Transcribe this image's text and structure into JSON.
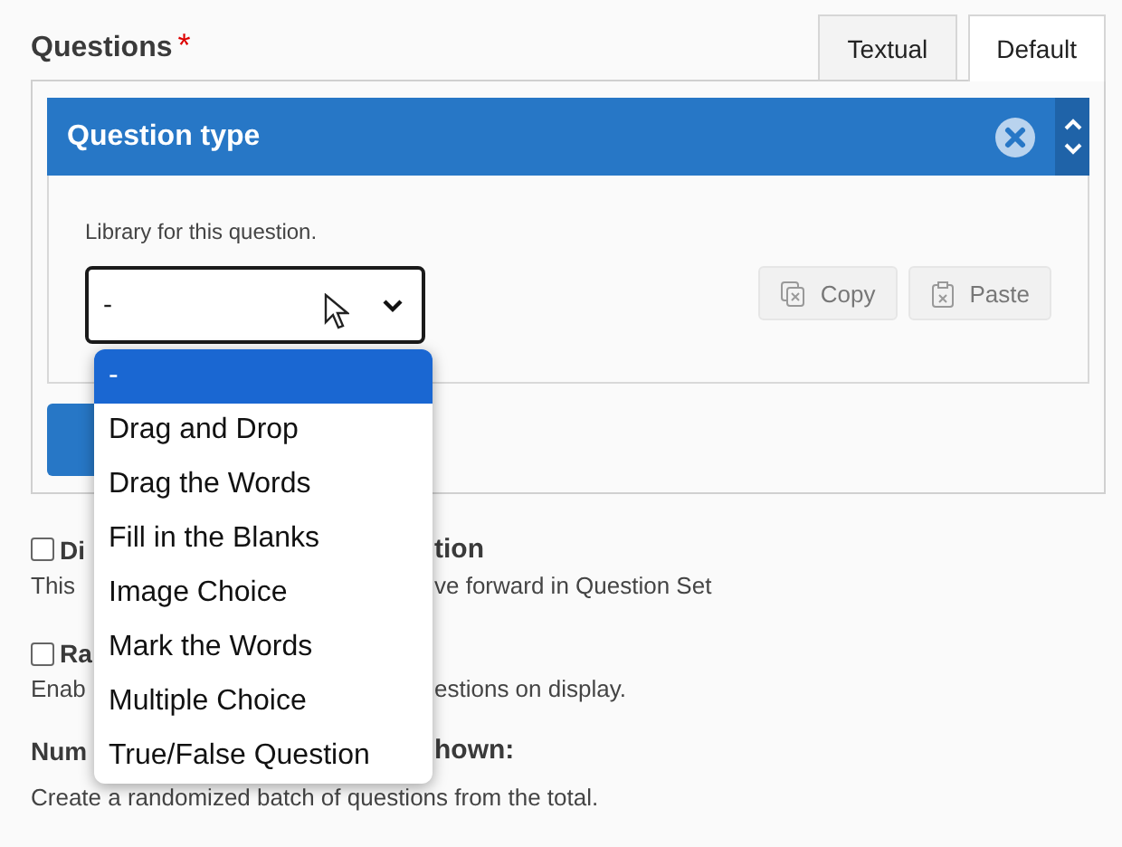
{
  "field": {
    "label": "Questions",
    "required_mark": "*"
  },
  "tabs": [
    {
      "label": "Textual",
      "selected": false
    },
    {
      "label": "Default",
      "selected": true
    }
  ],
  "question_type": {
    "title": "Question type",
    "library_label": "Library for this question.",
    "select_value": "-",
    "buttons": [
      "Copy",
      "Paste"
    ]
  },
  "dropdown": {
    "options": [
      {
        "label": "-",
        "selected": true
      },
      {
        "label": "Drag and Drop",
        "selected": false
      },
      {
        "label": "Drag the Words",
        "selected": false
      },
      {
        "label": "Fill in the Blanks",
        "selected": false
      },
      {
        "label": "Image Choice",
        "selected": false
      },
      {
        "label": "Mark the Words",
        "selected": false
      },
      {
        "label": "Multiple Choice",
        "selected": false
      },
      {
        "label": "True/False Question",
        "selected": false
      }
    ]
  },
  "settings": [
    {
      "kind": "checkbox",
      "checked": false,
      "left": "Di",
      "right": "tion"
    },
    {
      "kind": "note",
      "left": "This",
      "right": "ve forward in Question Set"
    },
    {
      "kind": "checkbox",
      "checked": false,
      "left": "Ra"
    },
    {
      "kind": "note",
      "left": "Enab",
      "right": "estions on display."
    },
    {
      "kind": "heading",
      "left": "Num",
      "right": "hown:"
    },
    {
      "kind": "note",
      "left": "Create a randomized batch of questions from the total."
    }
  ]
}
